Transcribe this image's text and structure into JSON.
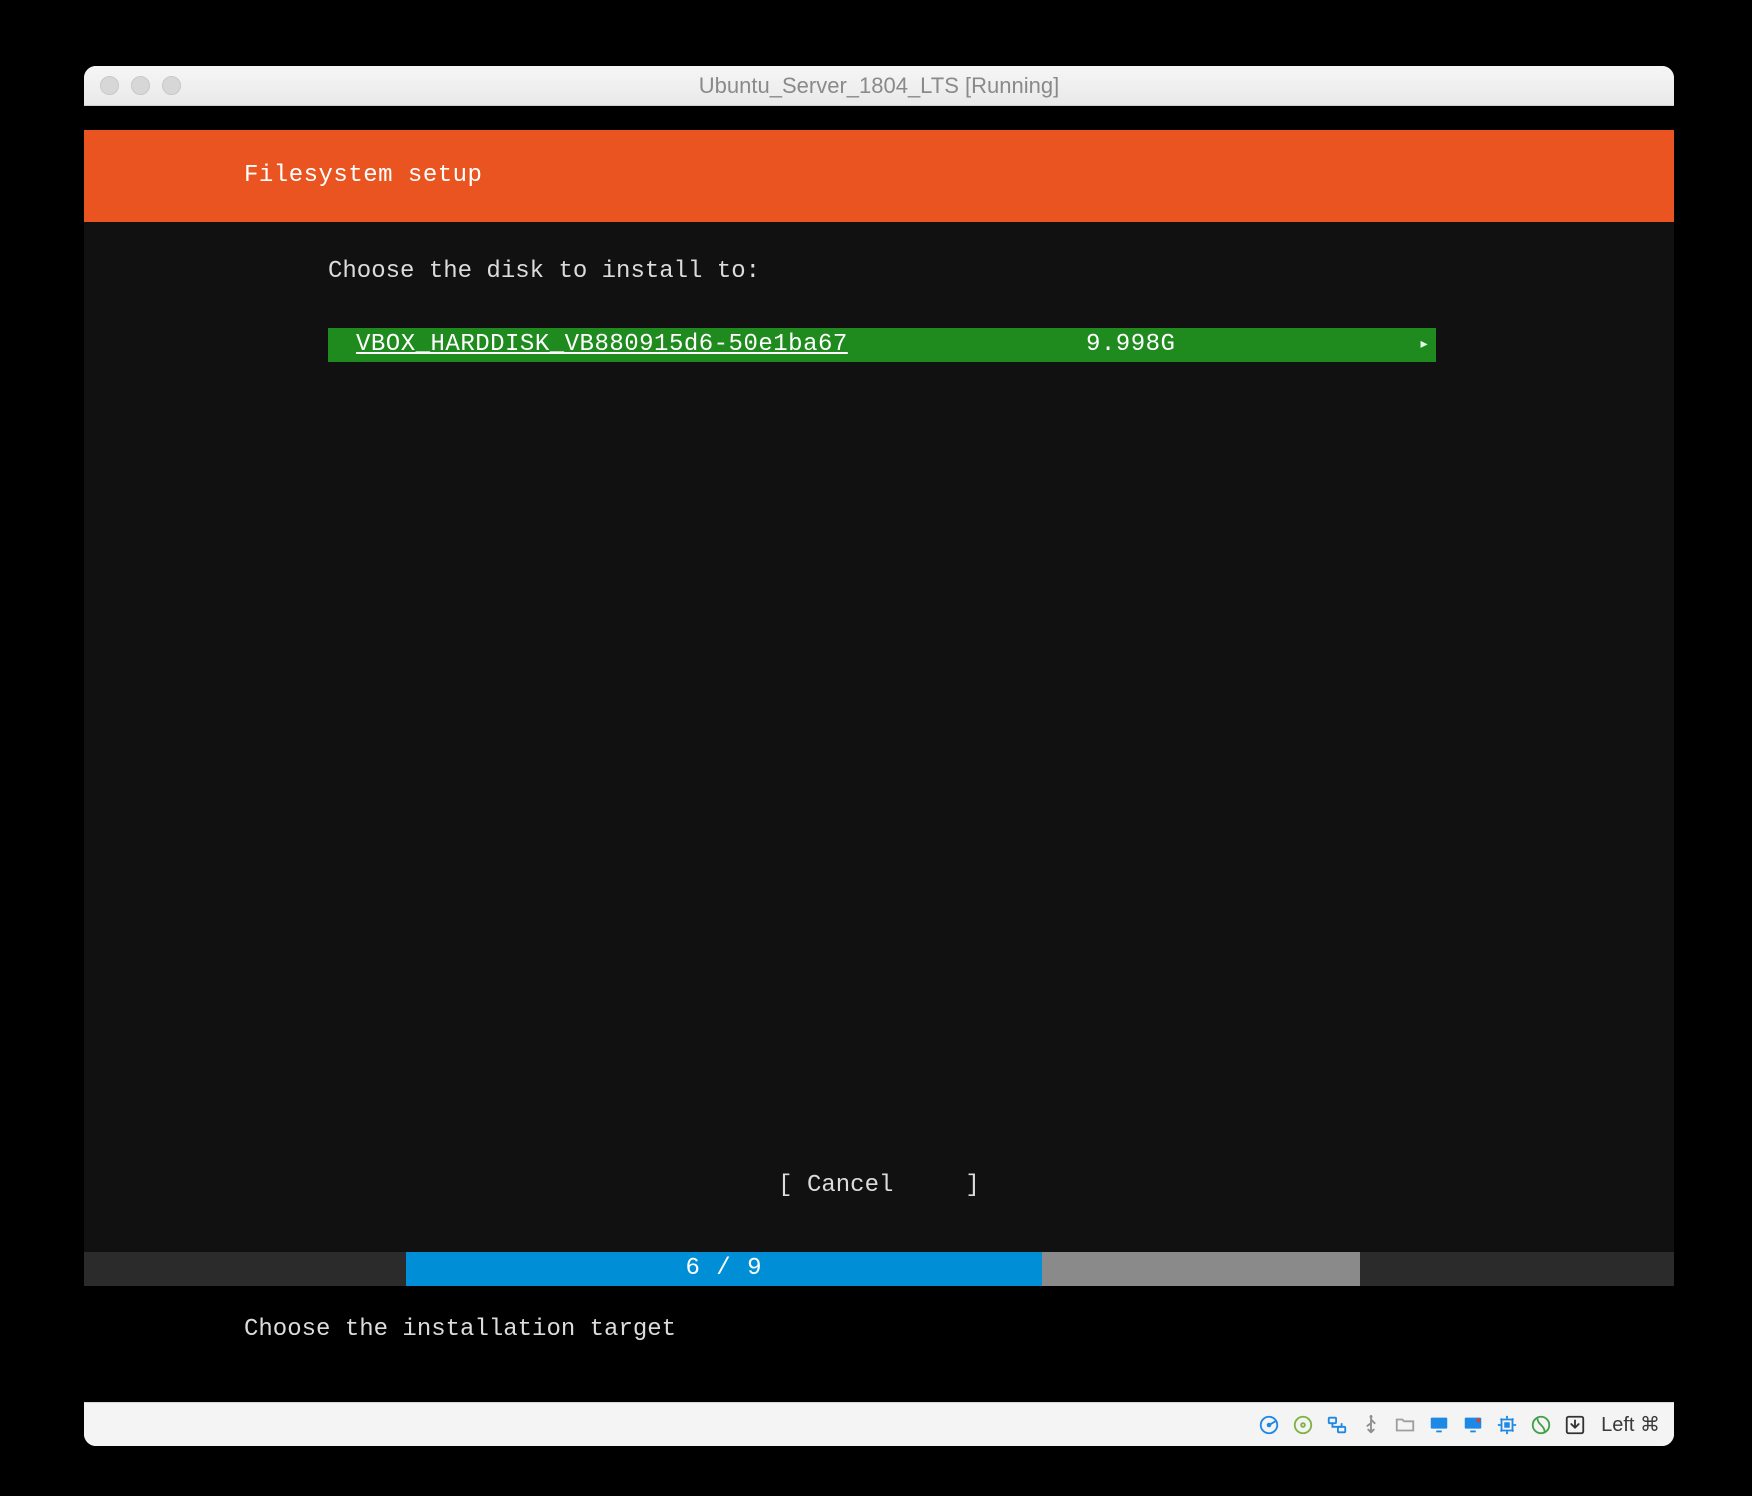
{
  "window": {
    "title": "Ubuntu_Server_1804_LTS [Running]"
  },
  "installer": {
    "header": "Filesystem setup",
    "prompt": "Choose the disk to install to:",
    "disk": {
      "name": "VBOX_HARDDISK_VB880915d6-50e1ba67",
      "size": "9.998G",
      "arrow": "▸"
    },
    "cancel": "[ Cancel     ]",
    "progress": {
      "label": "6 / 9",
      "current": 6,
      "total": 9
    },
    "hint": "Choose the installation target"
  },
  "statusbar": {
    "hostkey_label": "Left ⌘",
    "icons": [
      "hard-disk-icon",
      "optical-disk-icon",
      "network-icon",
      "usb-icon",
      "shared-folder-icon",
      "display-icon",
      "recording-icon",
      "cpu-icon",
      "mouse-integration-icon",
      "keyboard-capture-icon"
    ]
  }
}
